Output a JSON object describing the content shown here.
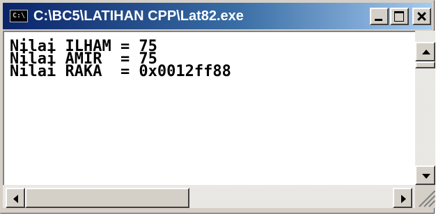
{
  "window": {
    "title": "C:\\BC5\\LATIHAN CPP\\Lat82.exe",
    "icon_label": "C:\\",
    "icons": {
      "app": "console-app-icon",
      "minimize": "minimize-icon",
      "maximize": "maximize-icon",
      "close": "close-icon"
    },
    "colors": {
      "titlebar_start": "#0a246a",
      "titlebar_end": "#a6caf0",
      "face": "#d4d0c8",
      "console_bg": "#ffffff",
      "console_text": "#000000"
    }
  },
  "console": {
    "lines": [
      "Nilai ILHAM = 75",
      "Nilai AMIR  = 75",
      "Nilai RAKA  = 0x0012ff88"
    ]
  },
  "scrollbars": {
    "vertical_position": 0,
    "horizontal_position": 0
  }
}
